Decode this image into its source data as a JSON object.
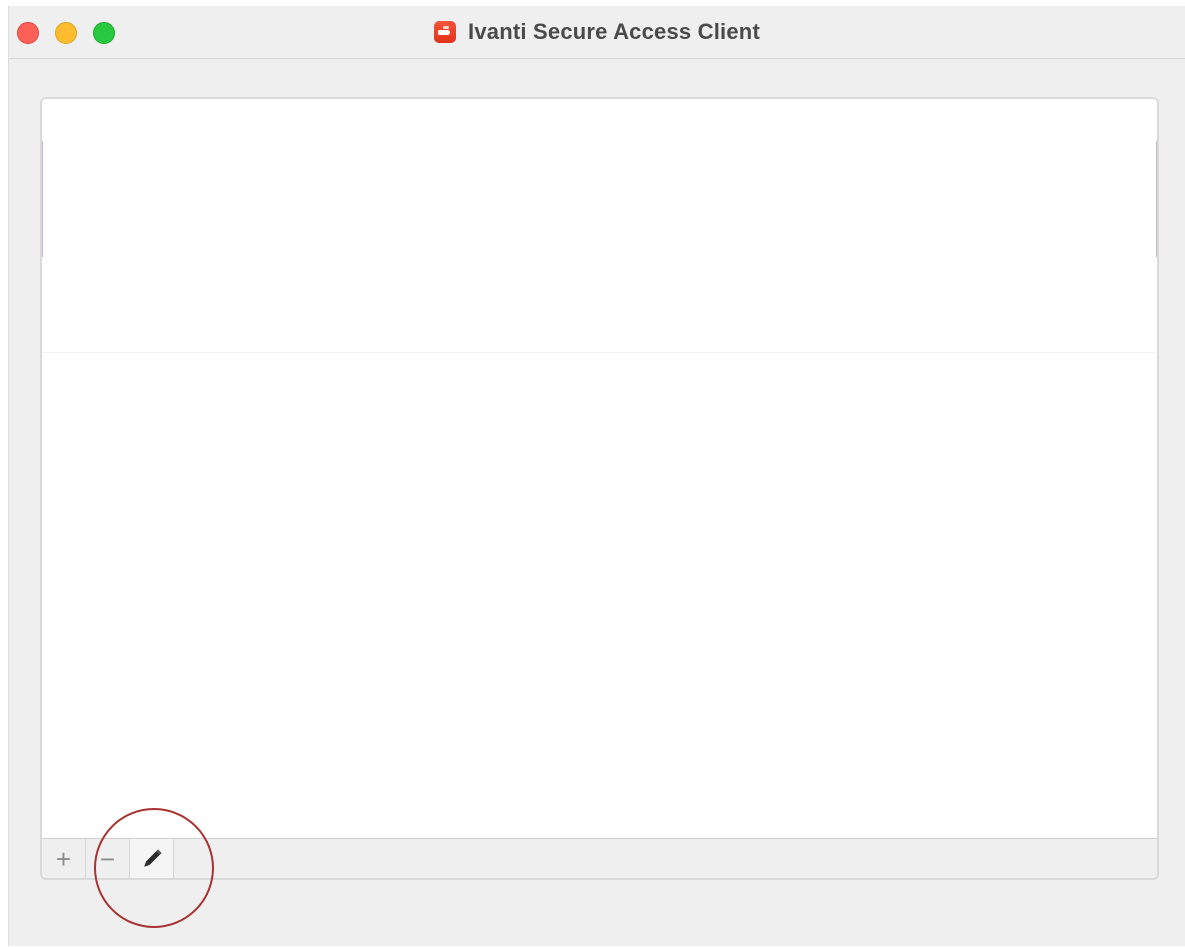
{
  "window": {
    "title": "Ivanti Secure Access Client",
    "app_icon": "ivanti-app-icon"
  },
  "traffic_lights": {
    "close_color": "#fe5f57",
    "minimize_color": "#febc2e",
    "zoom_color": "#28c840"
  },
  "connections_list": {
    "items": []
  },
  "toolbar": {
    "add_label": "+",
    "remove_label": "−",
    "edit_icon": "pencil-icon"
  },
  "annotation": {
    "highlight_color": "#a83232",
    "highlight_target": "edit-button"
  }
}
